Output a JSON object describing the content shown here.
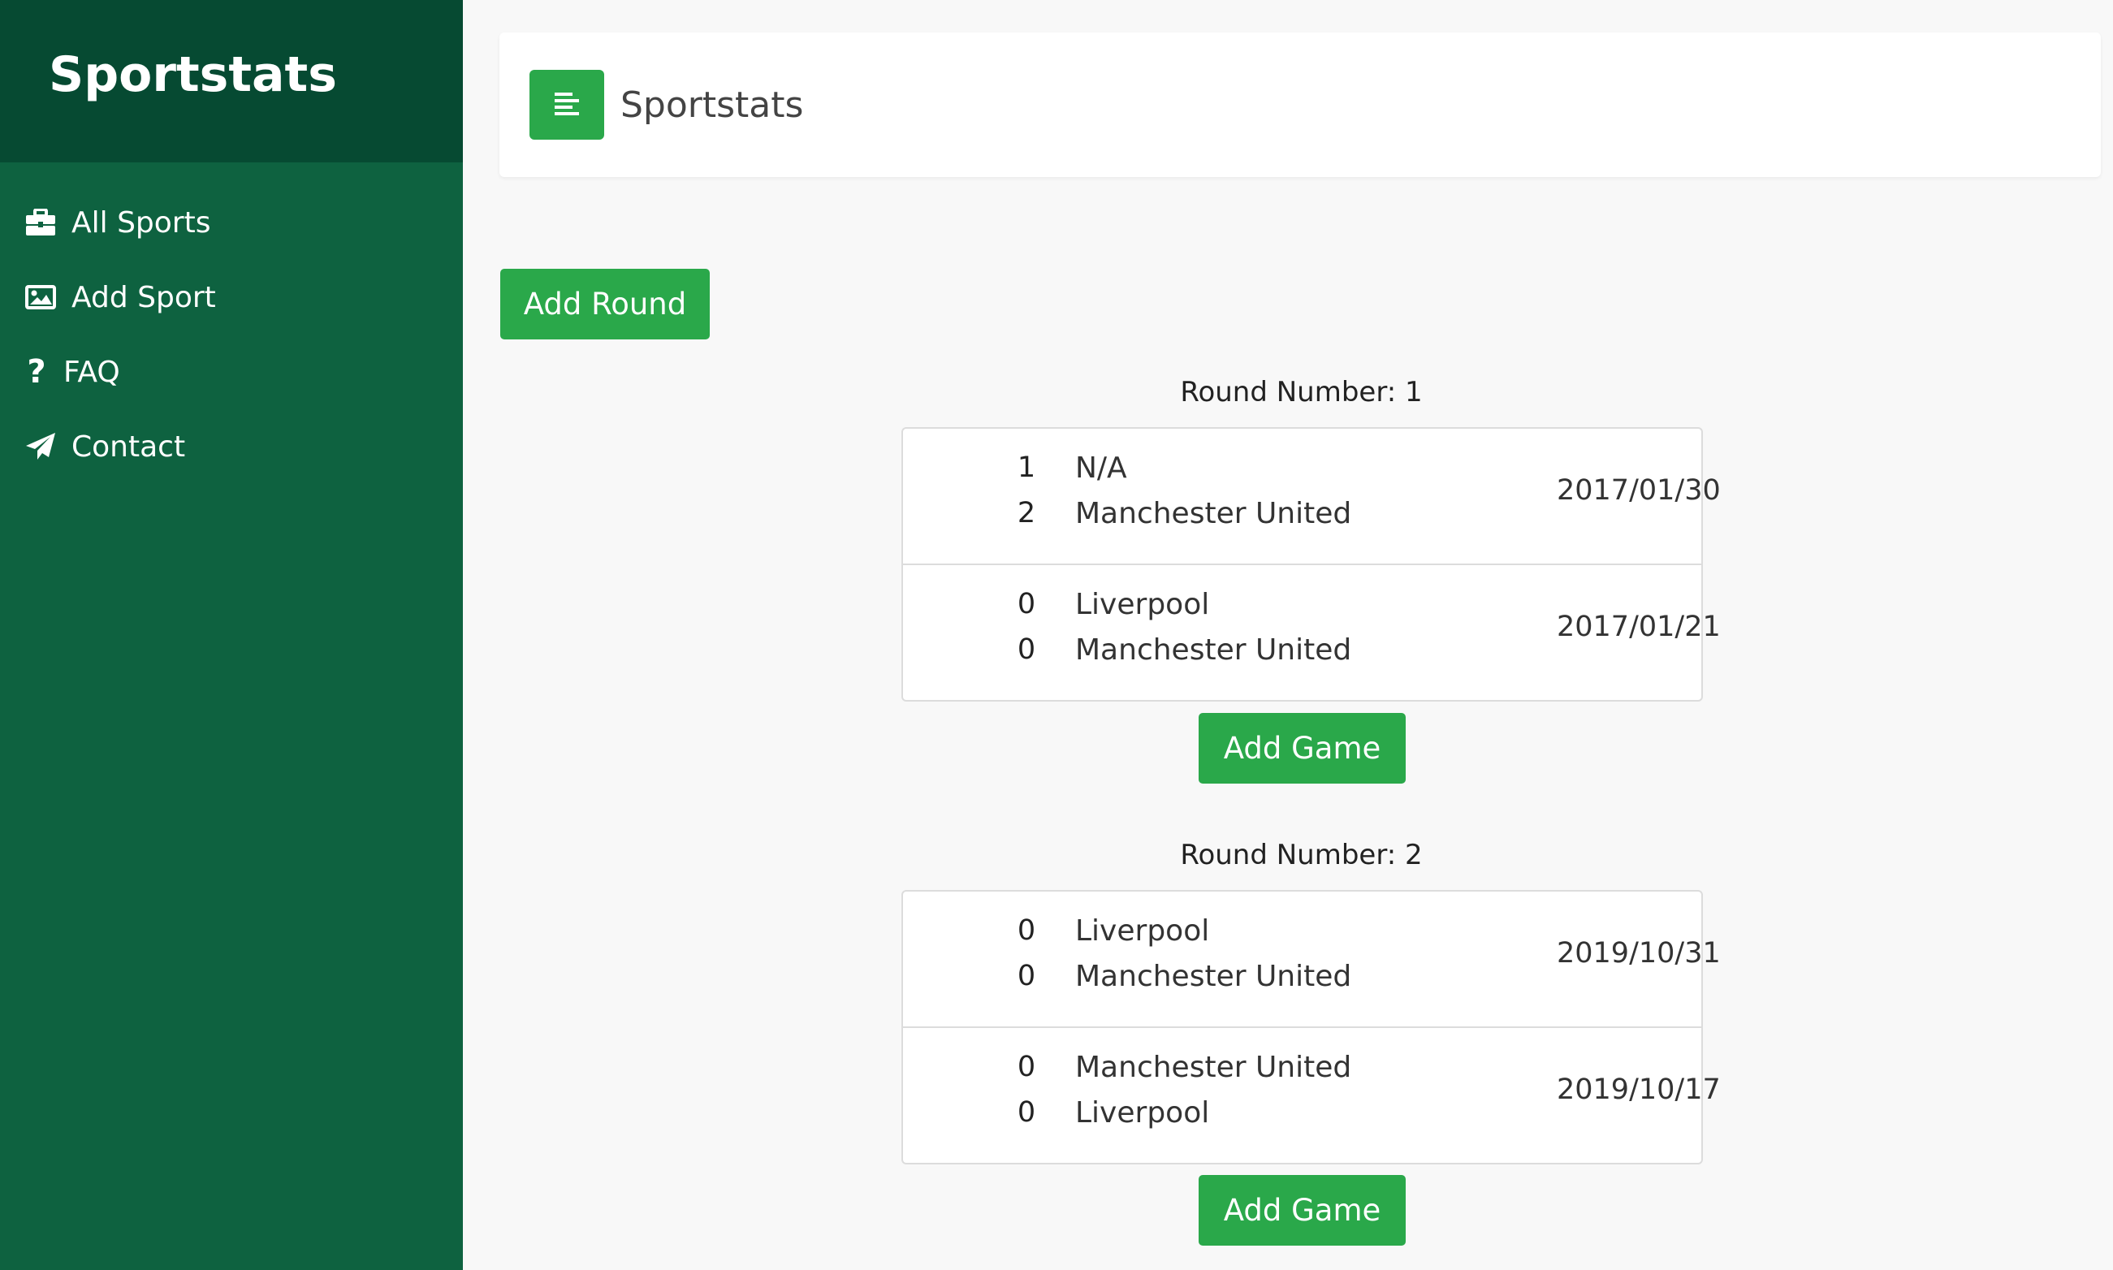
{
  "sidebar": {
    "brand": "Sportstats",
    "items": [
      {
        "label": "All Sports",
        "icon": "briefcase-icon"
      },
      {
        "label": "Add Sport",
        "icon": "image-icon"
      },
      {
        "label": "FAQ",
        "icon": "question-icon"
      },
      {
        "label": "Contact",
        "icon": "paper-plane-icon"
      }
    ]
  },
  "header": {
    "menu_icon": "align-left-icon",
    "title": "Sportstats"
  },
  "main": {
    "add_round_label": "Add Round",
    "rounds": [
      {
        "title": "Round Number: 1",
        "add_game_label": "Add Game",
        "games": [
          {
            "score1": "1",
            "team1": "N/A",
            "score2": "2",
            "team2": "Manchester United",
            "date": "2017/01/30"
          },
          {
            "score1": "0",
            "team1": "Liverpool",
            "score2": "0",
            "team2": "Manchester United",
            "date": "2017/01/21"
          }
        ]
      },
      {
        "title": "Round Number: 2",
        "add_game_label": "Add Game",
        "games": [
          {
            "score1": "0",
            "team1": "Liverpool",
            "score2": "0",
            "team2": "Manchester United",
            "date": "2019/10/31"
          },
          {
            "score1": "0",
            "team1": "Manchester United",
            "score2": "0",
            "team2": "Liverpool",
            "date": "2019/10/17"
          }
        ]
      }
    ]
  },
  "colors": {
    "sidebar_bg": "#0e6240",
    "brand_bg": "#064a32",
    "accent_green": "#2aa84a",
    "page_bg": "#f8f8f8"
  }
}
